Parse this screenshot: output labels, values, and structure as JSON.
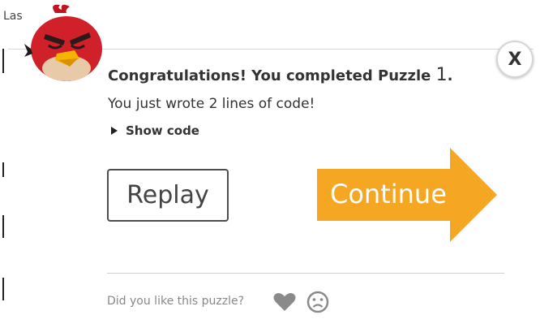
{
  "background": {
    "top_text": "Las"
  },
  "dialog": {
    "title_prefix": "Congratulations! You completed Puzzle ",
    "puzzle_number": "1",
    "title_suffix": ".",
    "subtitle": "You just wrote 2 lines of code!",
    "show_code_label": "Show code",
    "close_label": "X",
    "replay_label": "Replay",
    "continue_label": "Continue",
    "feedback_question": "Did you like this puzzle?"
  },
  "colors": {
    "continue_orange": "#f5a623",
    "text_dark": "#333333",
    "text_muted": "#888888",
    "icon_gray": "#8a8a8a",
    "bird_red": "#d0202a"
  },
  "icons": {
    "avatar": "red-angry-bird-icon",
    "close": "close-icon",
    "disclosure": "triangle-right-icon",
    "like": "heart-icon",
    "dislike": "sad-face-icon"
  }
}
